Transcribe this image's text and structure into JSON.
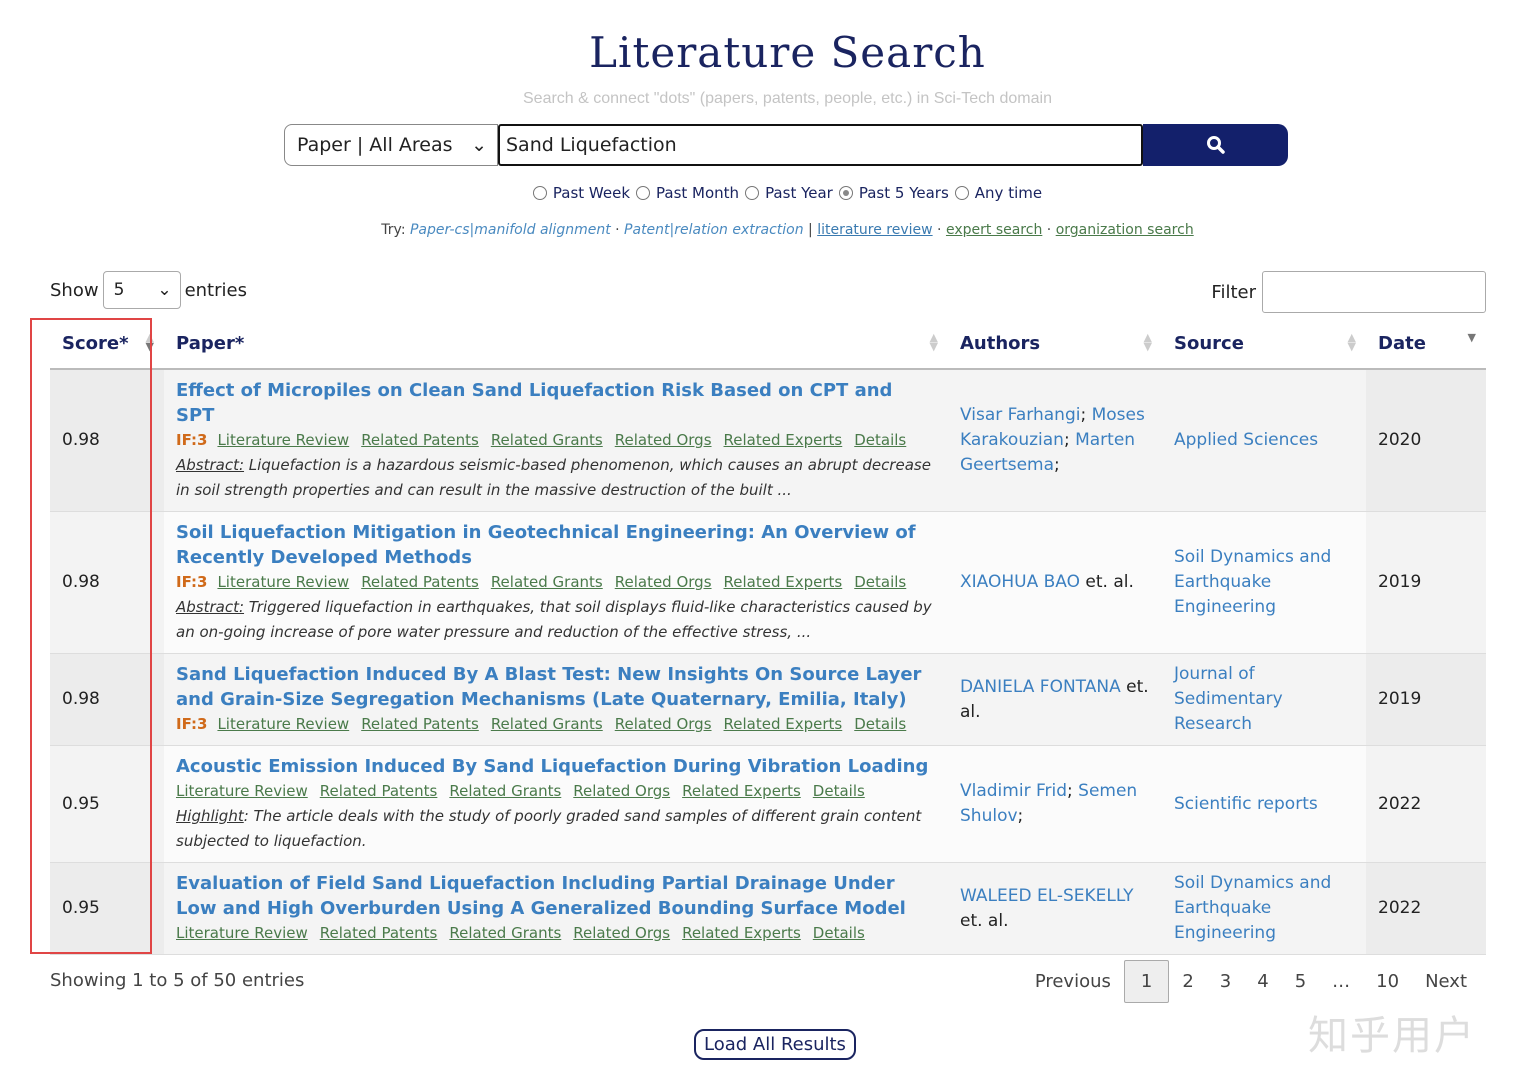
{
  "header": {
    "logo": "Literature Search",
    "tagline": "Search & connect \"dots\" (papers, patents, people, etc.) in Sci-Tech domain"
  },
  "search": {
    "area": "Paper | All Areas",
    "query": "Sand Liquefaction",
    "icon": "search-icon"
  },
  "time_filters": [
    {
      "label": "Past Week",
      "checked": false
    },
    {
      "label": "Past Month",
      "checked": false
    },
    {
      "label": "Past Year",
      "checked": false
    },
    {
      "label": "Past 5 Years",
      "checked": true
    },
    {
      "label": "Any time",
      "checked": false
    }
  ],
  "try": {
    "prefix": "Try:",
    "ex1": "Paper-cs|manifold alignment",
    "ex2": "Patent|relation extraction",
    "sep": "|",
    "l1": "literature review",
    "l2": "expert search",
    "l3": "organization search"
  },
  "table_controls": {
    "show": "Show",
    "entries_value": "5",
    "entries": "entries",
    "filter": "Filter"
  },
  "columns": [
    "Score*",
    "Paper*",
    "Authors",
    "Source",
    "Date"
  ],
  "rows": [
    {
      "score": "0.98",
      "title": "Effect of Micropiles on Clean Sand Liquefaction Risk Based on CPT and SPT",
      "if": "IF:3",
      "links": [
        "Literature Review",
        "Related Patents",
        "Related Grants",
        "Related Orgs",
        "Related Experts",
        "Details"
      ],
      "abs_label": "Abstract:",
      "abs": " Liquefaction is a hazardous seismic-based phenomenon, which causes an abrupt decrease in soil strength properties and can result in the massive destruction of the built ...",
      "authors": [
        "Visar Farhangi",
        "Moses Karakouzian",
        "Marten Geertsema"
      ],
      "etal": "",
      "source": "Applied Sciences",
      "date": "2020"
    },
    {
      "score": "0.98",
      "title": "Soil Liquefaction Mitigation in Geotechnical Engineering: An Overview of Recently Developed Methods",
      "if": "IF:3",
      "links": [
        "Literature Review",
        "Related Patents",
        "Related Grants",
        "Related Orgs",
        "Related Experts",
        "Details"
      ],
      "abs_label": "Abstract:",
      "abs": " Triggered liquefaction in earthquakes, that soil displays fluid-like characteristics caused by an on-going increase of pore water pressure and reduction of the effective stress, ...",
      "authors": [
        "XIAOHUA BAO"
      ],
      "etal": " et. al.",
      "source": "Soil Dynamics and Earthquake Engineering",
      "date": "2019"
    },
    {
      "score": "0.98",
      "title": "Sand Liquefaction Induced By A Blast Test: New Insights On Source Layer and Grain-Size Segregation Mechanisms (Late Quaternary, Emilia, Italy)",
      "if": "IF:3",
      "links": [
        "Literature Review",
        "Related Patents",
        "Related Grants",
        "Related Orgs",
        "Related Experts",
        "Details"
      ],
      "abs_label": "",
      "abs": "",
      "authors": [
        "DANIELA FONTANA"
      ],
      "etal": " et. al.",
      "source": "Journal of Sedimentary Research",
      "date": "2019"
    },
    {
      "score": "0.95",
      "title": "Acoustic Emission Induced By Sand Liquefaction During Vibration Loading",
      "if": "",
      "links": [
        "Literature Review",
        "Related Patents",
        "Related Grants",
        "Related Orgs",
        "Related Experts",
        "Details"
      ],
      "abs_label": "Highlight",
      "abs": ": The article deals with the study of poorly graded sand samples of different grain content subjected to liquefaction.",
      "authors": [
        "Vladimir Frid",
        "Semen Shulov"
      ],
      "etal": "",
      "source": "Scientific reports",
      "date": "2022"
    },
    {
      "score": "0.95",
      "title": "Evaluation of Field Sand Liquefaction Including Partial Drainage Under Low and High Overburden Using A Generalized Bounding Surface Model",
      "if": "",
      "links": [
        "Literature Review",
        "Related Patents",
        "Related Grants",
        "Related Orgs",
        "Related Experts",
        "Details"
      ],
      "abs_label": "",
      "abs": "",
      "authors": [
        "WALEED EL-SEKELLY"
      ],
      "etal": " et. al.",
      "source": "Soil Dynamics and Earthquake Engineering",
      "date": "2022"
    }
  ],
  "footer": {
    "info": "Showing 1 to 5 of 50 entries",
    "pages": [
      "Previous",
      "1",
      "2",
      "3",
      "4",
      "5",
      "…",
      "10",
      "Next"
    ],
    "current": "1",
    "load_all": "Load All Results",
    "watermark": "知乎用户"
  },
  "colors": {
    "brand": "#13206b",
    "link": "#3b7fc0",
    "sublink": "#4a7a4a",
    "highlight_box": "#e04545"
  }
}
